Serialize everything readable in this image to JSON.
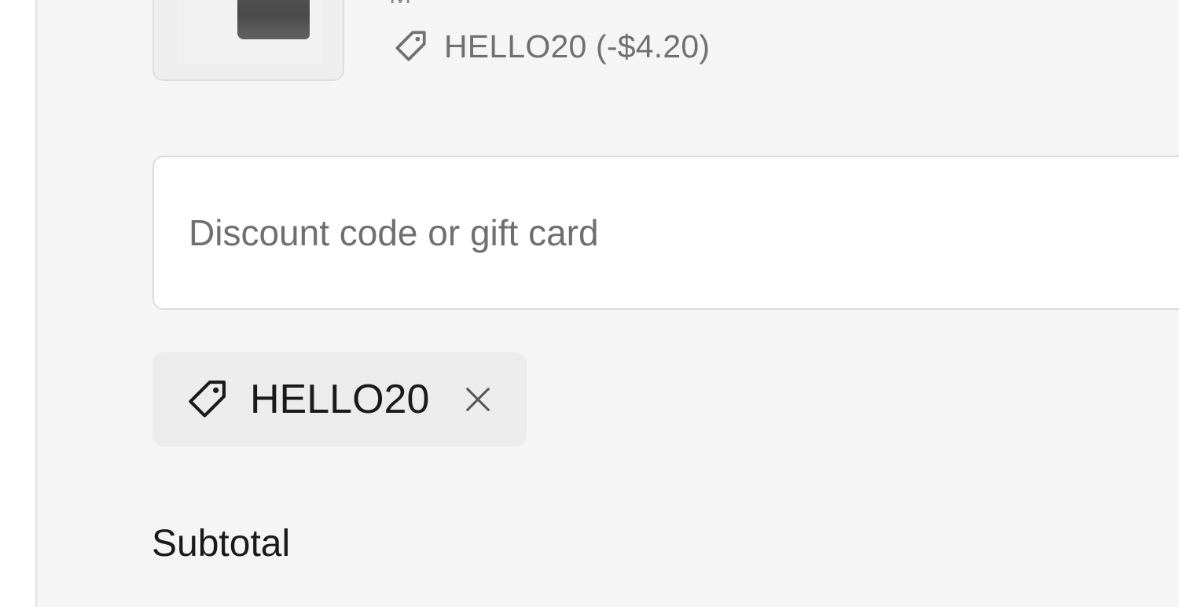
{
  "line_item": {
    "variant": "M",
    "discount_text": "HELLO20 (-$4.20)",
    "thumbnail_icon": "tshirt-image"
  },
  "discount_field": {
    "placeholder": "Discount code or gift card",
    "value": ""
  },
  "applied_code": {
    "label": "HELLO20",
    "tag_icon": "tag-icon",
    "remove_icon": "close-icon"
  },
  "summary": {
    "subtotal_label": "Subtotal"
  },
  "colors": {
    "panel_bg": "#f5f5f5",
    "chip_bg": "#ececec",
    "muted_text": "#707070",
    "primary_text": "#1a1a1a"
  }
}
